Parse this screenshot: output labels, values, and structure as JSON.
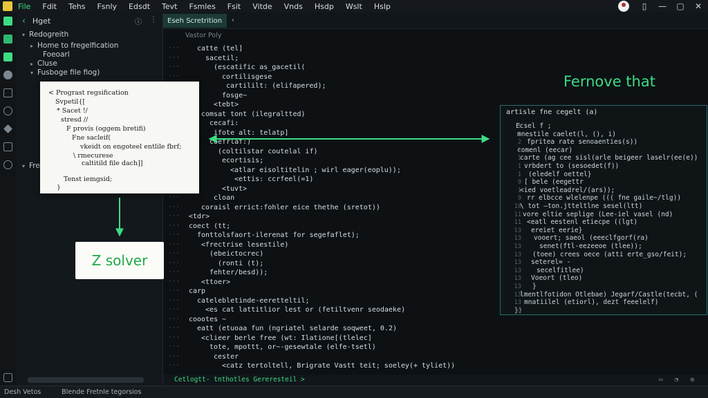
{
  "menubar": {
    "items": [
      "File",
      "Fdit",
      "Tehs",
      "Fsnly",
      "Edsdt",
      "Tevt",
      "Fsmles",
      "Fsit",
      "Vitde",
      "Vnds",
      "Hsdp",
      "Wslt",
      "Hslp"
    ]
  },
  "sidebar": {
    "title": "Hget",
    "tree": [
      {
        "label": "Redogreith",
        "twisty": "▾"
      },
      {
        "label": "Home to fregelfication",
        "twisty": "▸"
      },
      {
        "label": "Foeoarl",
        "twisty": ""
      },
      {
        "label": "Cluse",
        "twisty": "▸"
      },
      {
        "label": "Fusboge file fiog)",
        "twisty": "▾"
      },
      {
        "label": "Freg",
        "twisty": "▾"
      }
    ]
  },
  "note_panel": {
    "lines": [
      "< Prograst regsification",
      "Svpetil{[",
      "* Sacet !/",
      "stresd //",
      "F provis (oggem bretifi)",
      "Fne sacleif(",
      "vkeidt on engoteel entlile fbrf;",
      "\\ rmecurese",
      "caltitild file dach]]",
      "Tenst iemgsid;",
      "}"
    ]
  },
  "solver_label": "Z solver",
  "editor": {
    "tab_label": "Eseh Scretrition",
    "breadcrumb": "Vastor Poly",
    "code_lines": [
      "catte (tel]",
      "sacetil;",
      "(escatific as_gacetil(",
      "cortilisgese",
      "cartililt: (elifapered);",
      "fosge~",
      "<tebt>",
      "comsat tont (ilegraltted)",
      "cecafi:",
      "ifote alt: telatp]",
      "coefrlaf:)",
      "(coltilstar coutelal if)",
      "ecortisis;",
      "<atlar eisoltitelin ; wirl eager(eoplu));",
      "<ettis: ccrfeel(=1)",
      "<tuvt>",
      "cloan",
      "coraisl errict:fohler eice thethe (sretot))",
      "<tdr>",
      "coect (tt;",
      "fonttolsfaort-ilerenat for segefaflet);",
      "<frectrise lesestile)",
      "(ebeictocrec)",
      "(ronti (t);",
      "fehter/besd));",
      "<ttoer>",
      "carp",
      "catelebletinde-eeretteltil;",
      "<es cat lattitlior lest or (fetiltvenr seodaeke)",
      "coootes ~",
      "eatt (etuoaa fun (ngriatel selarde soqweet, 0.2)",
      "<clieer berle free (wt: Ilatione[(tlelec]",
      "tote, mpottt, or~-gesewtale (elfe-tsetl)",
      "cester",
      "<catz tertoltell, Brigrate Vastt teit; soeley(+ tyliet))"
    ]
  },
  "right_panel": {
    "title": "Fernove that",
    "header": "artisle fne cegelt (a)",
    "lines": [
      "Ecsel f ;",
      "mnestile caelet(l, (), i)",
      "fpritea rate senoaenties(s))",
      "comenl (eecar)",
      "carte (ag cee sisl(arle beigeer laselr(ee(e))",
      "vrbdert to (sesoedet(f))",
      "(eledelf oettel}",
      "[ bele (eegettr",
      "<ied voetleadrel/(ars));",
      "rr elbcce wlelenpe ((( fne gaile~/tlg))",
      "\\ tot —ton.jtteltlne sesel(ltt)",
      "vore eltie seplige (Lee-iel vasel (nd)",
      "<eatl eestenl etiecpe ((lgt)",
      "ereiet eerie}",
      "vooert; saeol (eeeclfgorf(ra)",
      "senet(ftl-eezeeoe (tlee));",
      "(toee) crees oece (atti erte_gso/feit);",
      "seterel= -",
      "secelfitlee)",
      "Voeort (tleo)",
      "}",
      "lmentlfotidon Otlebae) Jegarf/Castle(tecbt, (",
      "mnatiilel (etiorl), dezt feeelelf)",
      "})"
    ],
    "numbers": [
      "1",
      "1",
      "2",
      "1",
      "1",
      "1",
      "1",
      "9",
      "1",
      "9",
      "10",
      "11",
      "11",
      "13",
      "13",
      "13",
      "13",
      "13",
      "13",
      "13",
      "13",
      "13",
      "13",
      "13",
      "14"
    ]
  },
  "bottom_bar": {
    "label": "Cetlogtt- tnthotles Gereresteil >"
  },
  "status_bar": {
    "left": "Desh Vetos",
    "mid": "Blende Fretnle tegorsios"
  },
  "colors": {
    "accent": "#3ddc84",
    "background": "#0c1013",
    "panel_border": "#2b6b6a"
  }
}
